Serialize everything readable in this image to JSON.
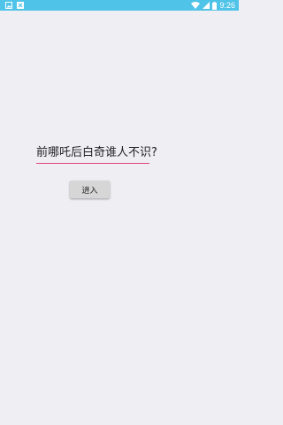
{
  "status_bar": {
    "time": "9:26",
    "icons_left": [
      "image-icon",
      "notification-icon"
    ],
    "icons_right": [
      "wifi-icon",
      "cell-signal-icon",
      "battery-icon"
    ],
    "background": "#4fc3e8"
  },
  "form": {
    "input_value": "前哪吒后白奇谁人不识?",
    "underline_color": "#e0457b"
  },
  "enter_button": {
    "label": "进入"
  },
  "colors": {
    "page_background": "#efeef3",
    "button_background": "#d6d6d6"
  }
}
